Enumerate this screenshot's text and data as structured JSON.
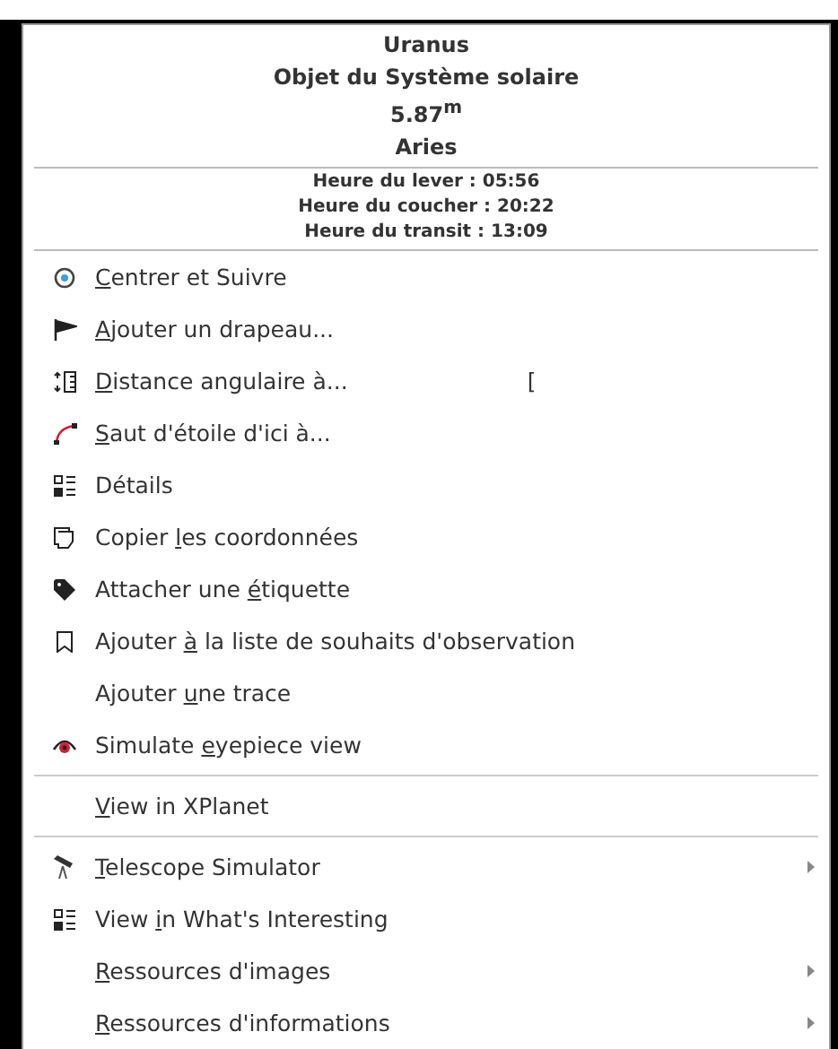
{
  "header": {
    "lines": [
      "Uranus",
      "Objet du Système solaire",
      "5.87$^{m}$",
      "Aries"
    ],
    "times": [
      "Heure du lever : 05:56",
      "Heure du coucher : 20:22",
      "Heure du transit : 13:09"
    ]
  },
  "sections": [
    {
      "items": [
        {
          "key": "C",
          "after": "entrer et Suivre",
          "submenu": false
        },
        {
          "key": "A",
          "after": "jouter un drapeau...",
          "submenu": false
        },
        {
          "key": "D",
          "after": "istance angulaire à...",
          "shortcut": "[",
          "submenu": false
        },
        {
          "key": "S",
          "after": "aut d'étoile d'ici à...",
          "submenu": false
        },
        {
          "before": "Détails",
          "submenu": false
        },
        {
          "before": "Copier ",
          "key": "l",
          "after": "es coordonnées",
          "submenu": false
        },
        {
          "before": "Attacher une ",
          "key": "é",
          "after": "tiquette",
          "submenu": false
        },
        {
          "before": "Ajouter ",
          "key": "à",
          "after": " la liste de souhaits d'observation",
          "submenu": false
        },
        {
          "before": "Ajouter ",
          "key": "u",
          "after": "ne trace",
          "submenu": false
        },
        {
          "before": "Simulate ",
          "key": "e",
          "after": "yepiece view",
          "submenu": false
        }
      ]
    },
    {
      "items": [
        {
          "key": "V",
          "after": "iew in XPlanet",
          "submenu": false
        }
      ]
    },
    {
      "items": [
        {
          "key": "T",
          "after": "elescope Simulator",
          "submenu": true
        },
        {
          "before": "View ",
          "key": "i",
          "after": "n What's Interesting",
          "submenu": false
        },
        {
          "key": "R",
          "after": "essources d'images",
          "submenu": true
        },
        {
          "key": "R",
          "after": "essources d'informations",
          "submenu": true
        }
      ]
    }
  ]
}
